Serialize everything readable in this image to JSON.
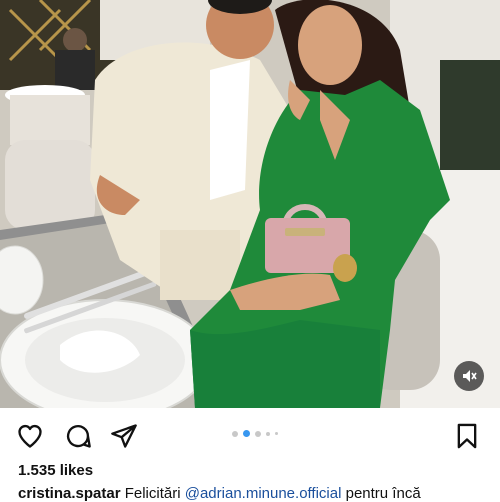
{
  "post": {
    "media": {
      "type": "photo",
      "description": "couple-seated-at-restaurant-table",
      "mute_icon": "speaker-muted-icon"
    },
    "carousel": {
      "count": 5,
      "active_index": 1
    },
    "actions": {
      "like_icon": "heart-icon",
      "comment_icon": "comment-icon",
      "share_icon": "share-icon",
      "save_icon": "bookmark-icon"
    },
    "likes_text": "1.535 likes",
    "caption": {
      "username": "cristina.spatar",
      "text_before_mention": "Felicitări",
      "mention": "@adrian.minune.official",
      "text_after_mention": "pentru încă"
    },
    "colors": {
      "mention": "#1a4f9c",
      "dot_active": "#3897f0",
      "dot_inactive": "#c8c8c8"
    }
  }
}
